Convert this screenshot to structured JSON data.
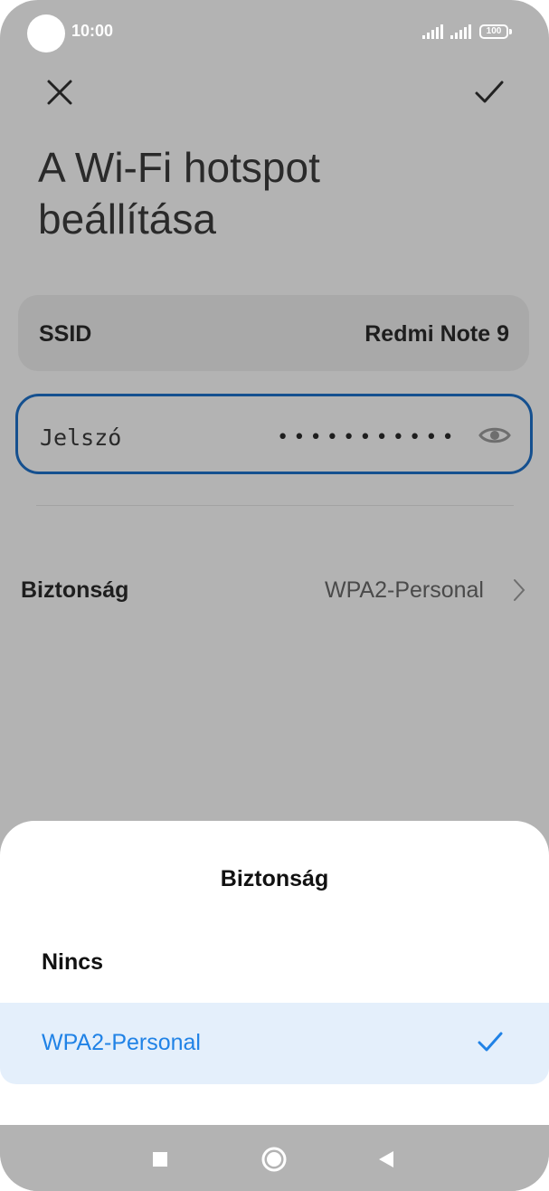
{
  "status_bar": {
    "time": "10:00",
    "battery": "100"
  },
  "header": {
    "title": "A Wi-Fi hotspot beállítása"
  },
  "ssid": {
    "label": "SSID",
    "value": "Redmi Note 9"
  },
  "password": {
    "label": "Jelszó",
    "value": "••••••••••••"
  },
  "security": {
    "label": "Biztonság",
    "value": "WPA2-Personal"
  },
  "sheet": {
    "title": "Biztonság",
    "options": [
      {
        "label": "Nincs",
        "selected": false
      },
      {
        "label": "WPA2-Personal",
        "selected": true
      }
    ]
  },
  "colors": {
    "accent": "#2082e6",
    "selected_bg": "#e4effb",
    "input_border": "#15508f"
  },
  "icons": [
    "close-icon",
    "check-icon",
    "eye-icon",
    "chevron-right-icon",
    "recent-apps-icon",
    "home-icon",
    "back-icon"
  ]
}
